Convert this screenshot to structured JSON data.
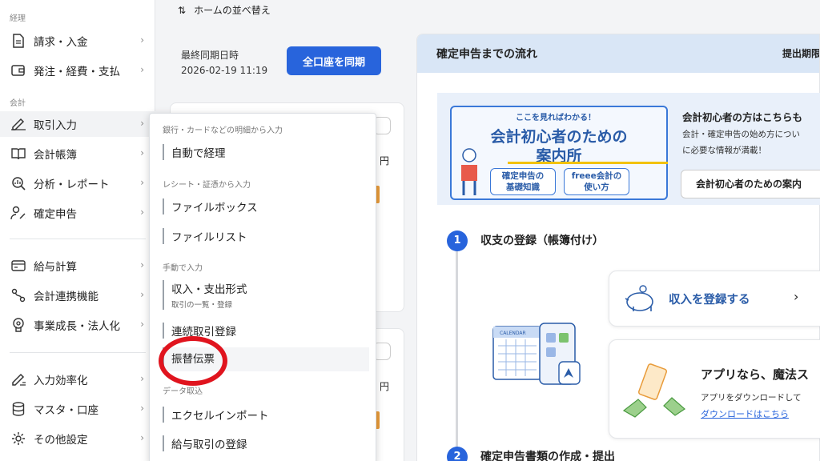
{
  "sidebar": {
    "sections": {
      "keiri": "経理",
      "kaikei": "会計"
    },
    "items": [
      {
        "label": "請求・入金",
        "icon": "document-icon"
      },
      {
        "label": "発注・経費・支払",
        "icon": "wallet-icon"
      },
      {
        "label": "取引入力",
        "icon": "pen-icon"
      },
      {
        "label": "会計帳簿",
        "icon": "book-icon"
      },
      {
        "label": "分析・レポート",
        "icon": "chart-search-icon"
      },
      {
        "label": "確定申告",
        "icon": "person-tax-icon"
      },
      {
        "label": "給与計算",
        "icon": "card-icon"
      },
      {
        "label": "会計連携機能",
        "icon": "link-icon"
      },
      {
        "label": "事業成長・法人化",
        "icon": "growth-icon"
      },
      {
        "label": "入力効率化",
        "icon": "pen-speed-icon"
      },
      {
        "label": "マスタ・口座",
        "icon": "database-icon"
      },
      {
        "label": "その他設定",
        "icon": "gear-icon"
      }
    ]
  },
  "main": {
    "home_sort": "ホームの並べ替え",
    "sync_label": "最終同期日時",
    "sync_time": "2026-02-19 11:19",
    "sync_button": "全口座を同期",
    "yen": "円"
  },
  "dropdown": {
    "sections": {
      "bank": "銀行・カードなどの明細から入力",
      "receipt": "レシート・証憑から入力",
      "manual": "手動で入力",
      "data": "データ取込"
    },
    "items": {
      "auto": "自動で経理",
      "filebox": "ファイルボックス",
      "filelist": "ファイルリスト",
      "income_expense": "収入・支出形式",
      "income_expense_sub": "取引の一覧・登録",
      "renzoku": "連続取引登録",
      "furikae": "振替伝票",
      "excel": "エクセルインポート",
      "payroll": "給与取引の登録"
    }
  },
  "right": {
    "header": "確定申告までの流れ",
    "header_right": "提出期限",
    "banner_small": "ここを見ればわかる！",
    "banner_title_1": "会計初心者のための",
    "banner_title_2": "案内所",
    "banner_tag_1": "確定申告の\n基礎知識",
    "banner_tag_2": "freee会計の\n使い方",
    "newbie_title": "会計初心者の方はこちらも",
    "newbie_desc_1": "会計・確定申告の始め方につい",
    "newbie_desc_2": "に必要な情報が満載！",
    "newbie_button": "会計初心者のための案内",
    "step1_num": "1",
    "step1_title": "収支の登録（帳簿付け）",
    "income_button": "収入を登録する",
    "app_title": "アプリなら、魔法ス",
    "app_desc": "アプリをダウンロードして",
    "app_link": "ダウンロードはこちら",
    "step2_num": "2",
    "step2_title": "確定申告書類の作成・提出",
    "calendar_label": "CALENDAR"
  },
  "colors": {
    "primary": "#2864dc",
    "highlight_circle": "#e0141e",
    "header_bg": "#d9e6f6"
  }
}
